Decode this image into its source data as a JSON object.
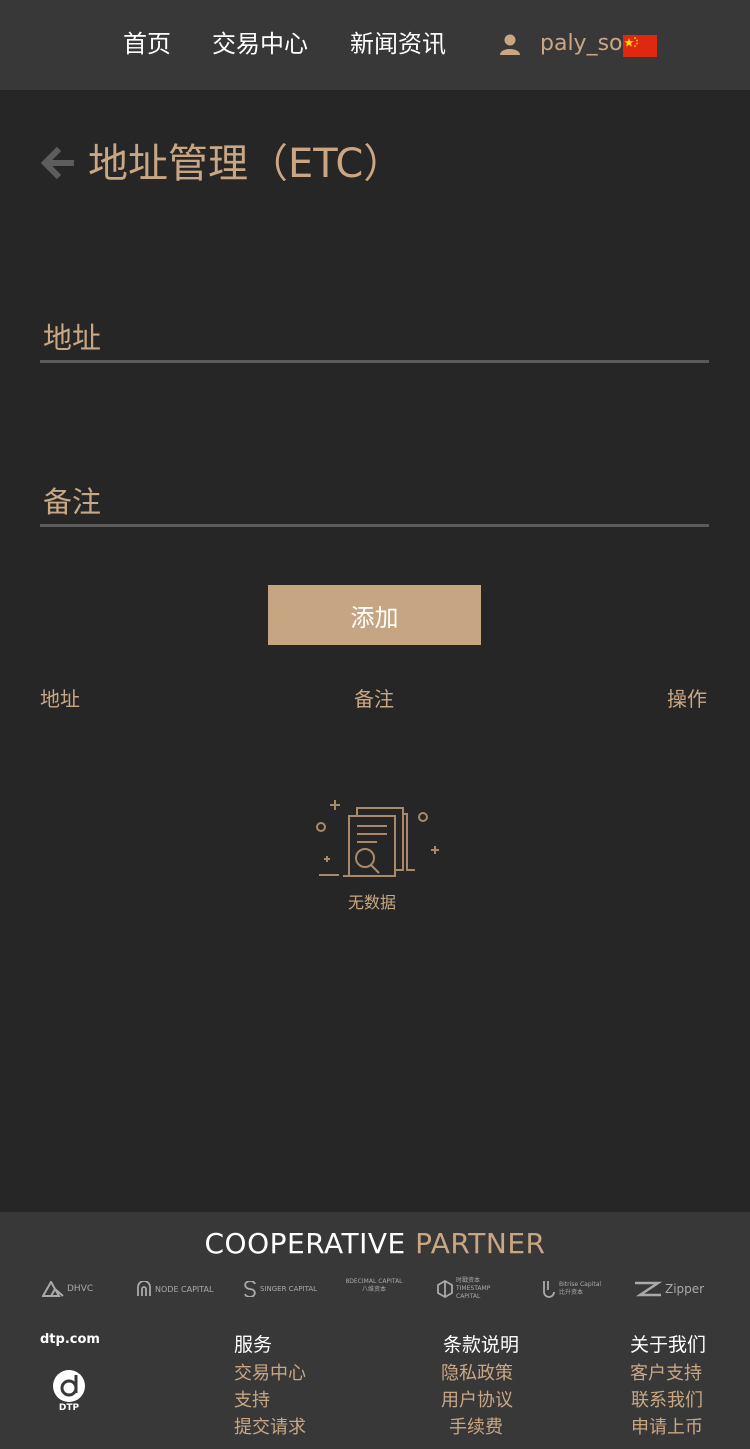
{
  "header": {
    "nav": [
      "首页",
      "交易中心",
      "新闻资讯"
    ],
    "username": "paly_so",
    "flag": "china-flag-icon"
  },
  "page": {
    "title": "地址管理（ETC）",
    "back_icon": "back-arrow-icon"
  },
  "form": {
    "address_label": "地址",
    "address_value": "",
    "remark_label": "备注",
    "remark_value": "",
    "add_button": "添加"
  },
  "table": {
    "columns": [
      "地址",
      "备注",
      "操作"
    ],
    "rows": [],
    "empty_text": "无数据",
    "empty_icon": "no-data-document-search-icon"
  },
  "footer": {
    "cooperative_word1": "COOPERATIVE",
    "cooperative_word2": "PARTNER",
    "partners": [
      "DHVC",
      "NODE CAPITAL",
      "SINGER CAPITAL",
      "8DECIMAL CAPITAL 八维资本",
      "时戳资本 TIMESTAMP CAPITAL",
      "Bitrise Capital 比升资本",
      "Zipper"
    ],
    "brand_domain": "dtp.com",
    "brand_logo_label": "DTP",
    "columns": [
      {
        "title": "服务",
        "links": [
          "交易中心",
          "支持",
          "提交请求"
        ]
      },
      {
        "title": "条款说明",
        "links": [
          "隐私政策",
          "用户协议",
          "手续费"
        ]
      },
      {
        "title": "关于我们",
        "links": [
          "客户支持",
          "联系我们",
          "申请上币"
        ]
      }
    ]
  },
  "colors": {
    "background": "#262626",
    "header": "#383838",
    "accent": "#c9a784",
    "button": "#c6a682"
  }
}
